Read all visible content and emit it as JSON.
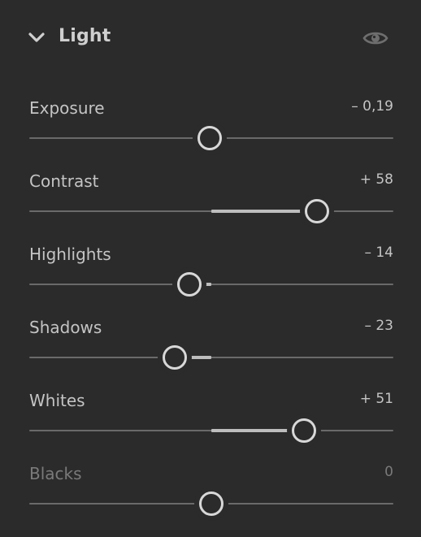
{
  "panel": {
    "title": "Light",
    "collapse_icon": "chevron-down-icon",
    "visibility_icon": "eye-icon"
  },
  "colors": {
    "background": "#2b2b2b",
    "track": "#6a6a6a",
    "track_fill": "#bdbdbd",
    "thumb": "#d8d8d8",
    "text": "#c4c4c4",
    "text_dim": "#7a7a7a"
  },
  "sliders": [
    {
      "id": "exposure",
      "label": "Exposure",
      "value_text": "– 0,19",
      "value": -0.19,
      "min": -5,
      "max": 5,
      "position": 0.4962
    },
    {
      "id": "contrast",
      "label": "Contrast",
      "value_text": "+ 58",
      "value": 58,
      "min": -100,
      "max": 100,
      "position": 0.79
    },
    {
      "id": "highlights",
      "label": "Highlights",
      "value_text": "– 14",
      "value": -14,
      "min": -100,
      "max": 100,
      "position": 0.44
    },
    {
      "id": "shadows",
      "label": "Shadows",
      "value_text": "– 23",
      "value": -23,
      "min": -100,
      "max": 100,
      "position": 0.4
    },
    {
      "id": "whites",
      "label": "Whites",
      "value_text": "+ 51",
      "value": 51,
      "min": -100,
      "max": 100,
      "position": 0.755
    },
    {
      "id": "blacks",
      "label": "Blacks",
      "value_text": "0",
      "value": 0,
      "min": -100,
      "max": 100,
      "position": 0.5,
      "dimmed": true
    }
  ]
}
